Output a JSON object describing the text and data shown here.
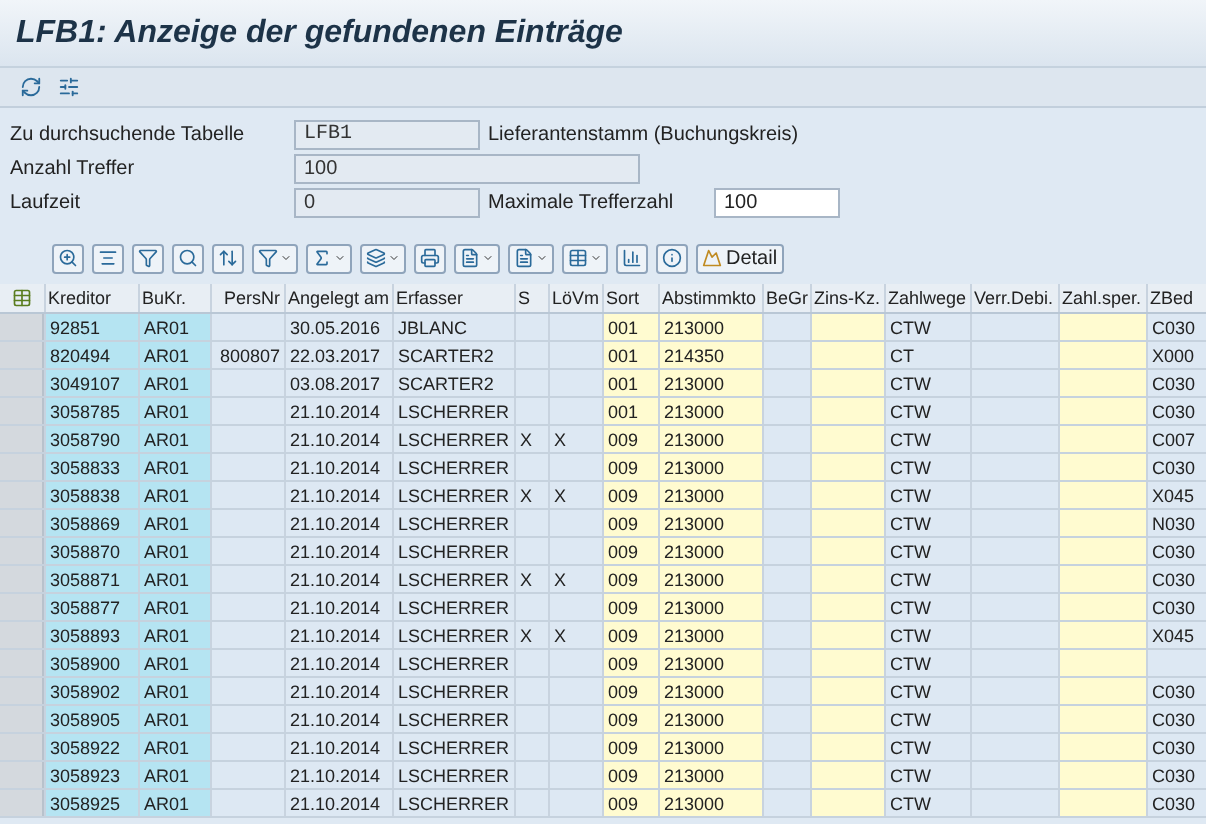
{
  "window": {
    "title": "LFB1: Anzeige der gefundenen Einträge"
  },
  "form": {
    "table_label": "Zu durchsuchende Tabelle",
    "table_value": "LFB1",
    "table_description": "Lieferantenstamm (Buchungskreis)",
    "hits_label": "Anzahl Treffer",
    "hits_value": "100",
    "runtime_label": "Laufzeit",
    "runtime_value": "0",
    "max_hits_label": "Maximale Trefferzahl",
    "max_hits_value": "100"
  },
  "alv_toolbar": {
    "detail_button": "Detail"
  },
  "table": {
    "columns": [
      {
        "label": "Kreditor",
        "kind": "key"
      },
      {
        "label": "BuKr.",
        "kind": "key"
      },
      {
        "label": "PersNr",
        "kind": "number"
      },
      {
        "label": "Angelegt am",
        "kind": "plain"
      },
      {
        "label": "Erfasser",
        "kind": "plain"
      },
      {
        "label": "S",
        "kind": "plain"
      },
      {
        "label": "LöVm",
        "kind": "plain"
      },
      {
        "label": "Sort",
        "kind": "input"
      },
      {
        "label": "Abstimmkto",
        "kind": "input"
      },
      {
        "label": "BeGr",
        "kind": "plain"
      },
      {
        "label": "Zins-Kz.",
        "kind": "input"
      },
      {
        "label": "Zahlwege",
        "kind": "plain"
      },
      {
        "label": "Verr.Debi.",
        "kind": "plain"
      },
      {
        "label": "Zahl.sper.",
        "kind": "input"
      },
      {
        "label": "ZBed",
        "kind": "plain"
      }
    ],
    "rows": [
      {
        "cells": [
          "92851",
          "AR01",
          null,
          "30.05.2016",
          "JBLANC",
          null,
          null,
          "001",
          "213000",
          null,
          null,
          "CTW",
          null,
          null,
          "C030"
        ]
      },
      {
        "cells": [
          "820494",
          "AR01",
          "800807",
          "22.03.2017",
          "SCARTER2",
          null,
          null,
          "001",
          "214350",
          null,
          null,
          "CT",
          null,
          null,
          "X000"
        ]
      },
      {
        "cells": [
          "3049107",
          "AR01",
          null,
          "03.08.2017",
          "SCARTER2",
          null,
          null,
          "001",
          "213000",
          null,
          null,
          "CTW",
          null,
          null,
          "C030"
        ]
      },
      {
        "cells": [
          "3058785",
          "AR01",
          null,
          "21.10.2014",
          "LSCHERRER",
          null,
          null,
          "001",
          "213000",
          null,
          null,
          "CTW",
          null,
          null,
          "C030"
        ]
      },
      {
        "cells": [
          "3058790",
          "AR01",
          null,
          "21.10.2014",
          "LSCHERRER",
          "X",
          "X",
          "009",
          "213000",
          null,
          null,
          "CTW",
          null,
          null,
          "C007"
        ]
      },
      {
        "cells": [
          "3058833",
          "AR01",
          null,
          "21.10.2014",
          "LSCHERRER",
          null,
          null,
          "009",
          "213000",
          null,
          null,
          "CTW",
          null,
          null,
          "C030"
        ]
      },
      {
        "cells": [
          "3058838",
          "AR01",
          null,
          "21.10.2014",
          "LSCHERRER",
          "X",
          "X",
          "009",
          "213000",
          null,
          null,
          "CTW",
          null,
          null,
          "X045"
        ]
      },
      {
        "cells": [
          "3058869",
          "AR01",
          null,
          "21.10.2014",
          "LSCHERRER",
          null,
          null,
          "009",
          "213000",
          null,
          null,
          "CTW",
          null,
          null,
          "N030"
        ]
      },
      {
        "cells": [
          "3058870",
          "AR01",
          null,
          "21.10.2014",
          "LSCHERRER",
          null,
          null,
          "009",
          "213000",
          null,
          null,
          "CTW",
          null,
          null,
          "C030"
        ]
      },
      {
        "cells": [
          "3058871",
          "AR01",
          null,
          "21.10.2014",
          "LSCHERRER",
          "X",
          "X",
          "009",
          "213000",
          null,
          null,
          "CTW",
          null,
          null,
          "C030"
        ]
      },
      {
        "cells": [
          "3058877",
          "AR01",
          null,
          "21.10.2014",
          "LSCHERRER",
          null,
          null,
          "009",
          "213000",
          null,
          null,
          "CTW",
          null,
          null,
          "C030"
        ]
      },
      {
        "cells": [
          "3058893",
          "AR01",
          null,
          "21.10.2014",
          "LSCHERRER",
          "X",
          "X",
          "009",
          "213000",
          null,
          null,
          "CTW",
          null,
          null,
          "X045"
        ]
      },
      {
        "cells": [
          "3058900",
          "AR01",
          null,
          "21.10.2014",
          "LSCHERRER",
          null,
          null,
          "009",
          "213000",
          null,
          null,
          "CTW",
          null,
          null,
          null
        ]
      },
      {
        "cells": [
          "3058902",
          "AR01",
          null,
          "21.10.2014",
          "LSCHERRER",
          null,
          null,
          "009",
          "213000",
          null,
          null,
          "CTW",
          null,
          null,
          "C030"
        ]
      },
      {
        "cells": [
          "3058905",
          "AR01",
          null,
          "21.10.2014",
          "LSCHERRER",
          null,
          null,
          "009",
          "213000",
          null,
          null,
          "CTW",
          null,
          null,
          "C030"
        ]
      },
      {
        "cells": [
          "3058922",
          "AR01",
          null,
          "21.10.2014",
          "LSCHERRER",
          null,
          null,
          "009",
          "213000",
          null,
          null,
          "CTW",
          null,
          null,
          "C030"
        ]
      },
      {
        "cells": [
          "3058923",
          "AR01",
          null,
          "21.10.2014",
          "LSCHERRER",
          null,
          null,
          "009",
          "213000",
          null,
          null,
          "CTW",
          null,
          null,
          "C030"
        ]
      },
      {
        "cells": [
          "3058925",
          "AR01",
          null,
          "21.10.2014",
          "LSCHERRER",
          null,
          null,
          "009",
          "213000",
          null,
          null,
          "CTW",
          null,
          null,
          "C030"
        ]
      }
    ]
  }
}
